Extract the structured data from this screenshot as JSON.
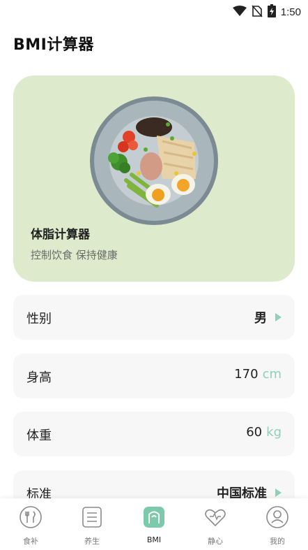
{
  "status_bar": {
    "time": "1:50",
    "icons": [
      "wifi-icon",
      "no-sim-icon",
      "battery-charging-icon"
    ]
  },
  "header": {
    "title": "BMI计算器"
  },
  "hero": {
    "title": "体脂计算器",
    "subtitle": "控制饮食 保持健康",
    "background": "#ddebcc"
  },
  "form": {
    "gender": {
      "label": "性别",
      "value": "男"
    },
    "height": {
      "label": "身高",
      "value": "170",
      "unit": "cm"
    },
    "weight": {
      "label": "体重",
      "value": "60",
      "unit": "kg"
    },
    "standard": {
      "label": "标准",
      "value": "中国标准"
    }
  },
  "tabbar": {
    "tabs": [
      {
        "label": "食补",
        "icon": "cutlery-icon"
      },
      {
        "label": "养生",
        "icon": "list-icon"
      },
      {
        "label": "BMI",
        "icon": "scale-icon",
        "active": true
      },
      {
        "label": "静心",
        "icon": "heart-icon"
      },
      {
        "label": "我的",
        "icon": "user-icon"
      }
    ]
  },
  "colors": {
    "accent": "#8fd0b6",
    "active_tab": "#7cc9ab"
  }
}
